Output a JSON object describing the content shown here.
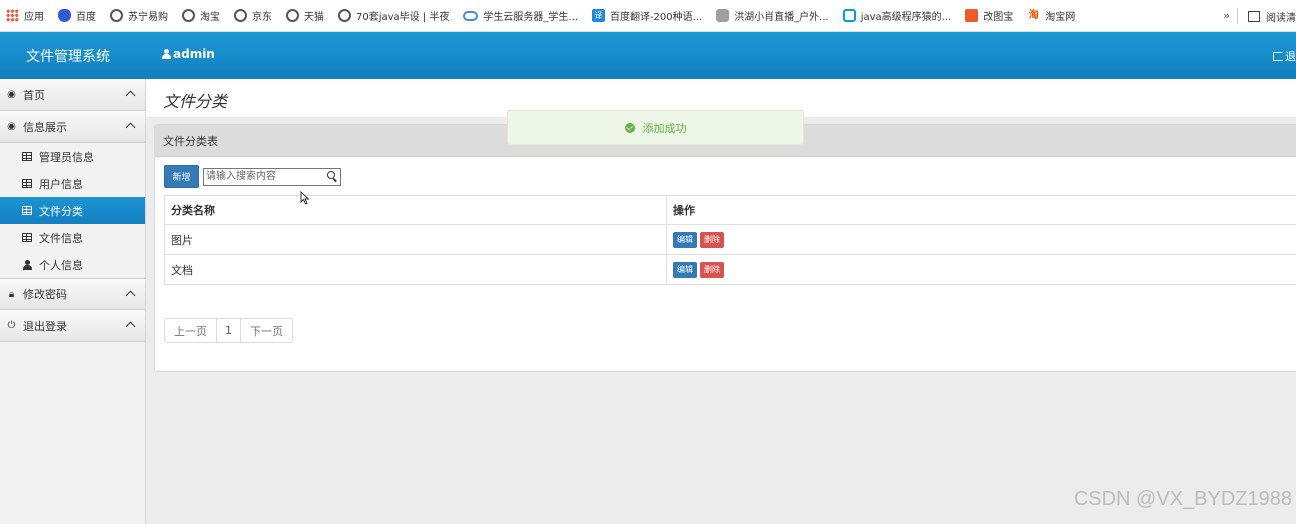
{
  "bookmarks": {
    "items": [
      {
        "label": "应用",
        "icon": "apps-grid-icon"
      },
      {
        "label": "百度",
        "icon": "baidu-paw-icon"
      },
      {
        "label": "苏宁易购",
        "icon": "globe-icon"
      },
      {
        "label": "淘宝",
        "icon": "globe-icon"
      },
      {
        "label": "京东",
        "icon": "globe-icon"
      },
      {
        "label": "天猫",
        "icon": "globe-icon"
      },
      {
        "label": "70套java毕设 | 半夜",
        "icon": "globe-icon"
      },
      {
        "label": "学生云服务器_学生...",
        "icon": "cloud-icon"
      },
      {
        "label": "百度翻译-200种语...",
        "icon": "translate-icon"
      },
      {
        "label": "洪湖小肖直播_户外...",
        "icon": "hat-icon"
      },
      {
        "label": "java高级程序猿的...",
        "icon": "bilibili-tv-icon"
      },
      {
        "label": "改图宝",
        "icon": "gaitubao-icon"
      },
      {
        "label": "淘宝网",
        "icon": "taobao-icon"
      }
    ],
    "more": "»",
    "reading_list": "阅读清"
  },
  "header": {
    "brand": "文件管理系统",
    "user": "admin",
    "logout": "退"
  },
  "sidebar": {
    "groups": [
      {
        "label": "首页",
        "icon": "dashboard-icon"
      },
      {
        "label": "信息展示",
        "icon": "dashboard-icon",
        "items": [
          {
            "label": "管理员信息",
            "icon": "table-icon",
            "active": false
          },
          {
            "label": "用户信息",
            "icon": "table-icon",
            "active": false
          },
          {
            "label": "文件分类",
            "icon": "table-icon",
            "active": true
          },
          {
            "label": "文件信息",
            "icon": "table-icon",
            "active": false
          },
          {
            "label": "个人信息",
            "icon": "user-icon",
            "active": false
          }
        ]
      },
      {
        "label": "修改密码",
        "icon": "lock-icon"
      },
      {
        "label": "退出登录",
        "icon": "power-icon"
      }
    ]
  },
  "main": {
    "page_title": "文件分类",
    "panel_title": "文件分类表",
    "add_button": "新增",
    "search_placeholder": "请输入搜索内容",
    "table": {
      "columns": [
        "分类名称",
        "操作"
      ],
      "rows": [
        {
          "name": "图片",
          "edit": "编辑",
          "delete": "删除"
        },
        {
          "name": "文档",
          "edit": "编辑",
          "delete": "删除"
        }
      ]
    },
    "pager": {
      "prev": "上一页",
      "current": "1",
      "next": "下一页"
    }
  },
  "toast": {
    "message": "添加成功"
  },
  "watermark": "CSDN @VX_BYDZ1988",
  "colors": {
    "header": "#1589c9",
    "active_menu": "#1787c8",
    "success": "#61b33d",
    "primary_button": "#337ab7",
    "danger_button": "#d9534f"
  }
}
